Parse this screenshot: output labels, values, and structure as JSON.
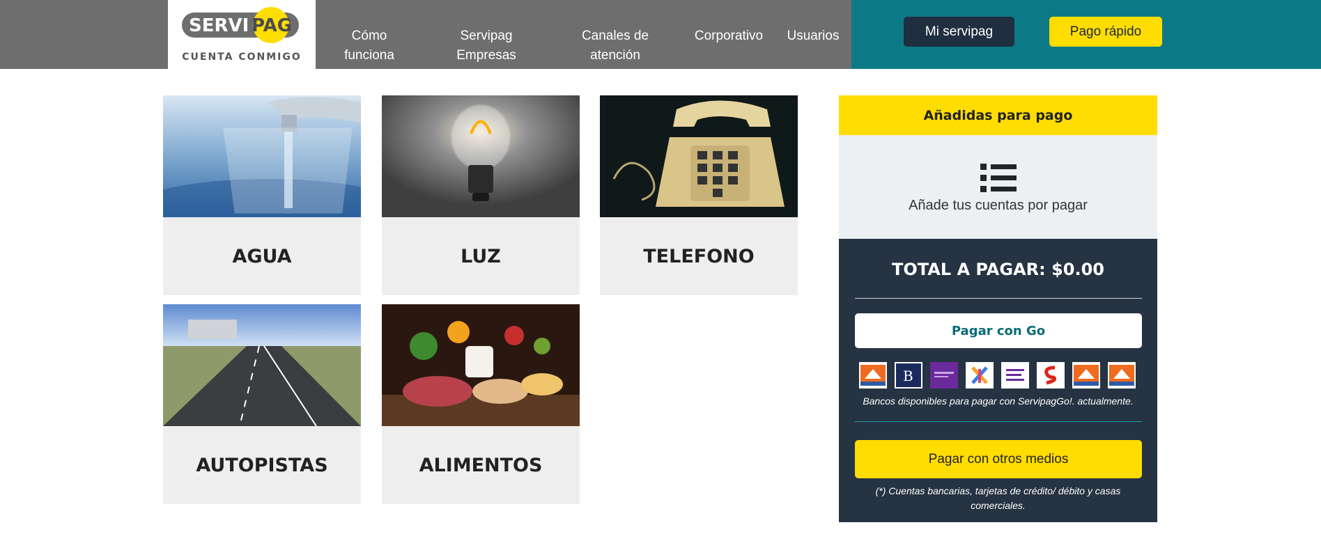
{
  "header": {
    "logo": {
      "brand_left": "SERVI",
      "brand_right": "PAG",
      "tagline": "CUENTA CONMIGO"
    },
    "nav": [
      {
        "line1": "Cómo",
        "line2": "funciona"
      },
      {
        "line1": "Servipag",
        "line2": "Empresas"
      },
      {
        "line1": "Canales de",
        "line2": "atención"
      },
      {
        "line1": "Corporativo",
        "line2": ""
      },
      {
        "line1": "Usuarios",
        "line2": ""
      }
    ],
    "mi_servipag": "Mi servipag",
    "pago_rapido": "Pago rápido"
  },
  "categories": [
    {
      "label": "AGUA",
      "image": "water-glass-tap"
    },
    {
      "label": "LUZ",
      "image": "light-bulb"
    },
    {
      "label": "TELEFONO",
      "image": "rotary-telephone"
    },
    {
      "label": "AUTOPISTAS",
      "image": "highway"
    },
    {
      "label": "ALIMENTOS",
      "image": "food-table"
    }
  ],
  "panel": {
    "heading": "Añadidas para pago",
    "list_icon": "list-icon",
    "add_text": "Añade tus cuentas por pagar",
    "total": "TOTAL A PAGAR: $0.00",
    "pay_go": "Pagar con Go",
    "banks": [
      "bank-logo-1",
      "bank-logo-2",
      "bank-logo-3",
      "bank-logo-4",
      "bank-logo-5",
      "bank-logo-6",
      "bank-logo-7",
      "bank-logo-8"
    ],
    "banks_note": "Bancos disponibles para pagar con ServipagGo!. actualmente.",
    "pay_other": "Pagar con otros medios",
    "other_note": "(*) Cuentas bancarias, tarjetas de crédito/ débito y casas comerciales."
  },
  "colors": {
    "topbar": "#6e6e6e",
    "topbar_accent": "#0b7a86",
    "yellow": "#ffdd00",
    "dark_navy": "#253342"
  }
}
